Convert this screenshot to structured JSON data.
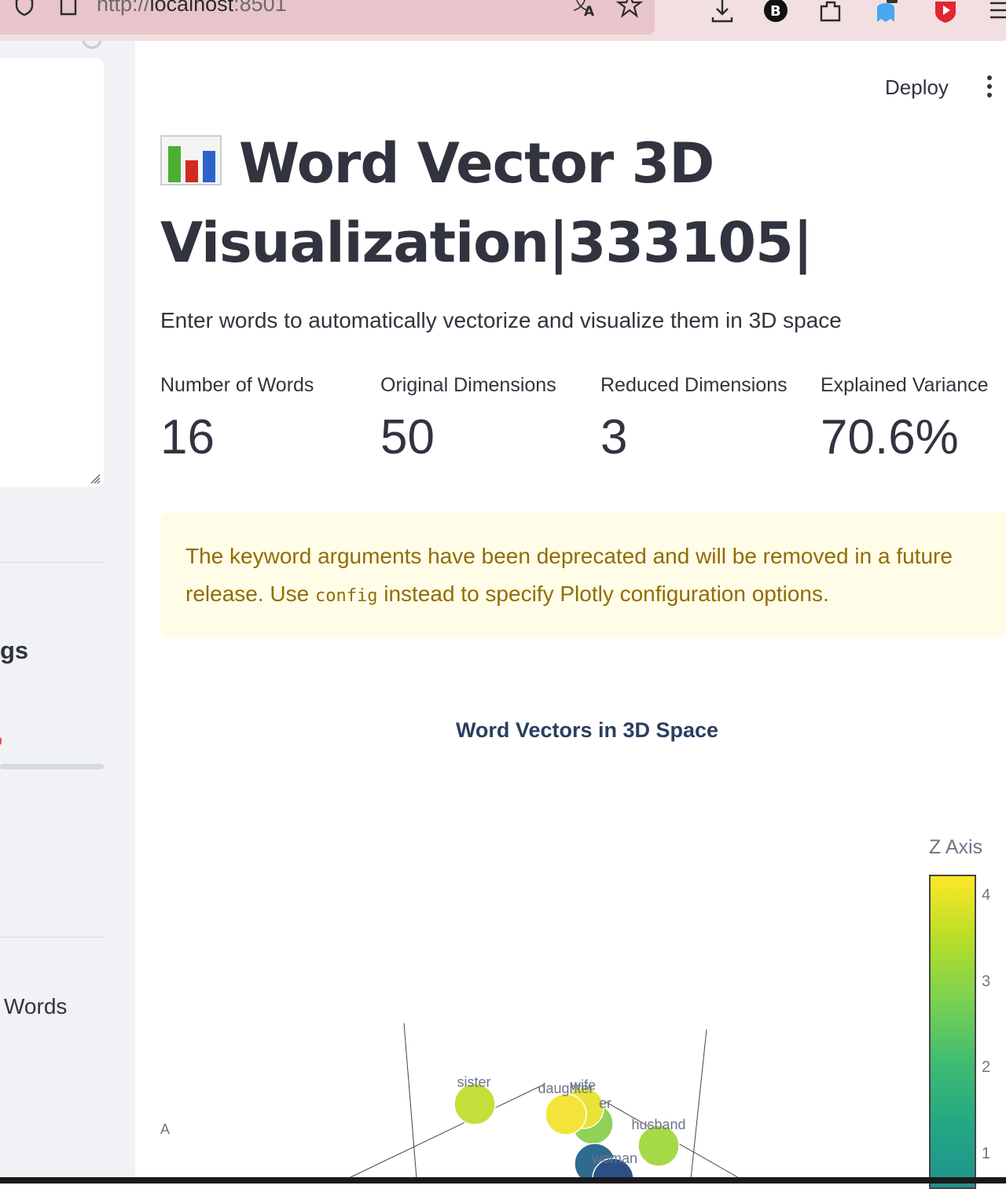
{
  "browser": {
    "url_scheme": "http://",
    "url_host": "localhost",
    "url_port": ":8501",
    "toolbar_icons": [
      "translate-icon",
      "bookmark-star-icon",
      "download-icon",
      "extension-b-icon",
      "extensions-icon",
      "ghost-extension-icon",
      "video-extension-icon",
      "menu-icon"
    ]
  },
  "sidebar": {
    "heading_fragment": "gs",
    "label_fragment": "Words"
  },
  "header": {
    "deploy_label": "Deploy"
  },
  "main": {
    "title_icon": "bar-chart-emoji",
    "title_line1": "Word Vector 3D",
    "title_line2": "Visualization|333105|",
    "subtitle": "Enter words to automatically vectorize and visualize them in 3D space",
    "metrics": [
      {
        "label": "Number of Words",
        "value": "16"
      },
      {
        "label": "Original Dimensions",
        "value": "50"
      },
      {
        "label": "Reduced Dimensions",
        "value": "3"
      },
      {
        "label": "Explained Variance",
        "value": "70.6%"
      }
    ],
    "warning": {
      "text_before": "The keyword arguments have been deprecated and will be removed in a future release. Use ",
      "code": "config",
      "text_after": " instead to specify Plotly configuration options."
    }
  },
  "chart_data": {
    "type": "scatter",
    "title": "Word Vectors in 3D Space",
    "colorbar_title": "Z Axis",
    "colorbar_ticks": [
      "4",
      "3",
      "2",
      "1"
    ],
    "colorscale": "viridis",
    "axis_fragment": "A",
    "visible_points": [
      {
        "label": "sister",
        "color": "#c2df3a"
      },
      {
        "label": "daughter",
        "color": "#f4e43a"
      },
      {
        "label": "wife",
        "color": "#e9e238"
      },
      {
        "label": "er",
        "color": "#8fd255"
      },
      {
        "label": "husband",
        "color": "#a6d947"
      },
      {
        "label": "woman",
        "color": "#2f6b8e"
      },
      {
        "label": "",
        "color": "#2c4f86"
      }
    ]
  }
}
